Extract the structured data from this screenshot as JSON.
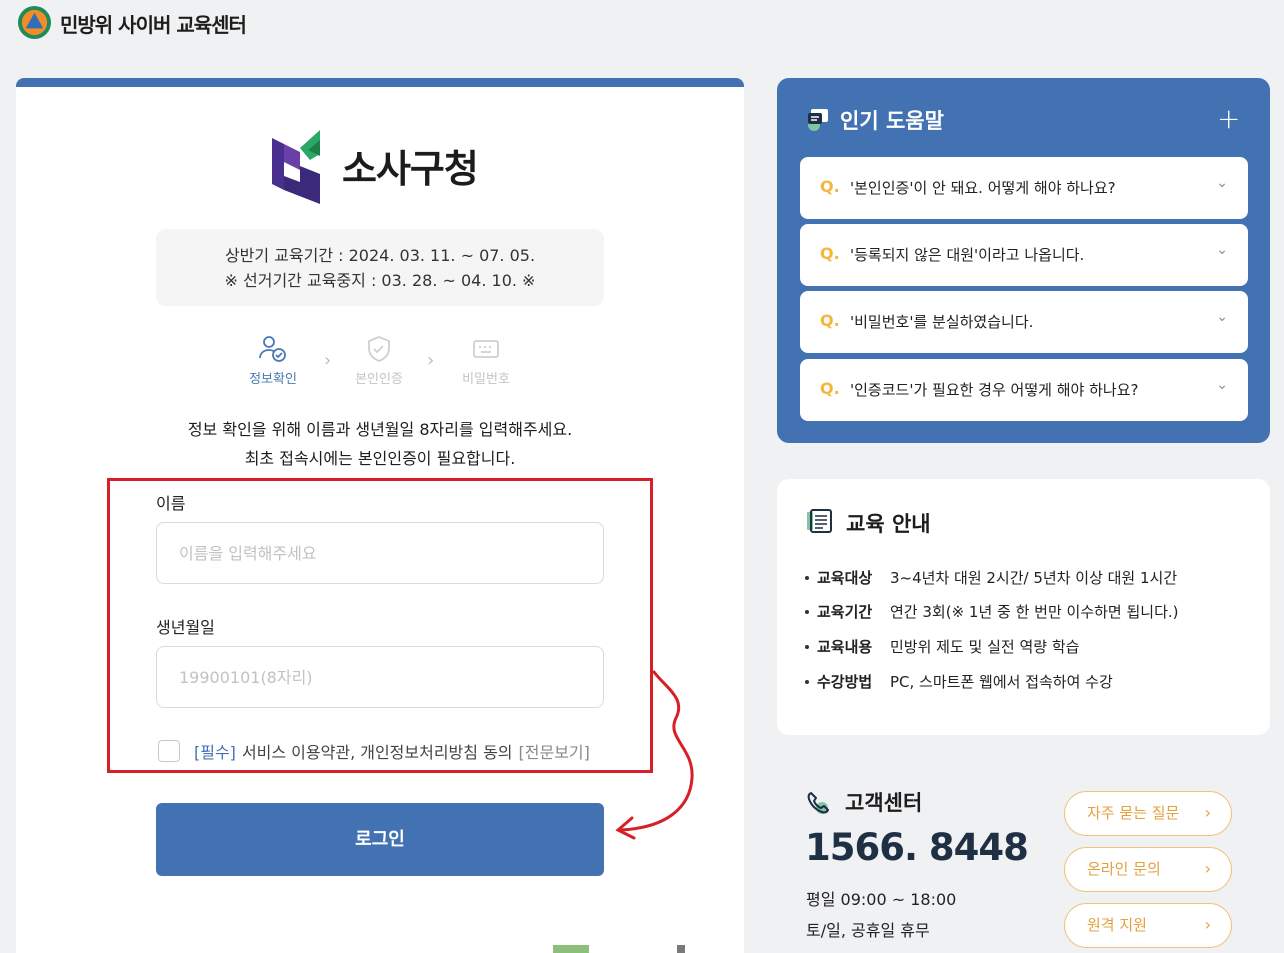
{
  "header": {
    "title": "민방위 사이버 교육센터"
  },
  "login": {
    "org_name": "소사구청",
    "period_line1": "상반기 교육기간 : 2024. 03. 11. ~ 07. 05.",
    "period_line2": "※ 선거기간 교육중지 : 03. 28. ~ 04. 10. ※",
    "steps": [
      {
        "label": "정보확인",
        "icon": "user-check-icon",
        "active": true
      },
      {
        "label": "본인인증",
        "icon": "shield-check-icon",
        "active": false
      },
      {
        "label": "비밀번호",
        "icon": "keyboard-icon",
        "active": false
      }
    ],
    "instruction_line1": "정보 확인을 위해 이름과 생년월일 8자리를 입력해주세요.",
    "instruction_line2": "최초 접속시에는 본인인증이 필요합니다.",
    "name_label": "이름",
    "name_placeholder": "이름을 입력해주세요",
    "name_value": "",
    "birth_label": "생년월일",
    "birth_placeholder": "19900101(8자리)",
    "birth_value": "",
    "agree_required": "[필수]",
    "agree_text": "서비스 이용약관, 개인정보처리방침 동의",
    "agree_more": "[전문보기]",
    "agree_checked": false,
    "login_button": "로그인"
  },
  "faq": {
    "title": "인기 도움말",
    "expand_symbol": "+",
    "q_prefix": "Q.",
    "items": [
      "'본인인증'이 안 돼요. 어떻게 해야 하나요?",
      "'등록되지 않은 대원'이라고 나옵니다.",
      "'비밀번호'를 분실하였습니다.",
      "'인증코드'가 필요한 경우 어떻게 해야 하나요?"
    ]
  },
  "education": {
    "title": "교육 안내",
    "rows": [
      {
        "key": "교육대상",
        "value": "3~4년차 대원 2시간/ 5년차 이상 대원 1시간"
      },
      {
        "key": "교육기간",
        "value": "연간 3회(※ 1년 중 한 번만 이수하면 됩니다.)"
      },
      {
        "key": "교육내용",
        "value": "민방위 제도 및 실전 역량 학습"
      },
      {
        "key": "수강방법",
        "value": "PC, 스마트폰 웹에서 접속하여 수강"
      }
    ]
  },
  "customer_center": {
    "title": "고객센터",
    "phone": "1566. 8448",
    "weekday_hours": "평일 09:00 ~ 18:00",
    "holiday": "토/일, 공휴일 휴무",
    "buttons": [
      "자주 묻는 질문",
      "온라인 문의",
      "원격 지원"
    ],
    "button_arrow": "›"
  },
  "colors": {
    "primary": "#4372b3",
    "accent": "#f5b63b",
    "annotation_red": "#d62027"
  }
}
